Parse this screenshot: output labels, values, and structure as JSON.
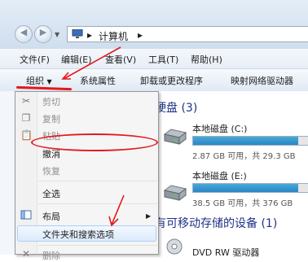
{
  "address": {
    "crumbs": [
      "计算机"
    ]
  },
  "menu": {
    "items": [
      "文件(F)",
      "编辑(E)",
      "查看(V)",
      "工具(T)",
      "帮助(H)"
    ]
  },
  "toolbar": {
    "organize_label": "组织",
    "items": [
      "系统属性",
      "卸载或更改程序",
      "映射网络驱动器"
    ]
  },
  "sections": {
    "hard_disks": "硬盘 (3)",
    "removable": "有可移动存储的设备 (1)"
  },
  "drives": [
    {
      "name": "本地磁盘 (C:)",
      "free_text": "2.87 GB 可用，共 29.3 GB",
      "used_fraction": 0.9
    },
    {
      "name": "本地磁盘 (E:)",
      "free_text": "38.5 GB 可用，共 376 GB",
      "used_fraction": 0.9
    },
    {
      "name": "DVD RW 驱动器"
    }
  ],
  "context_menu": {
    "items": [
      {
        "label": "剪切",
        "icon": "scissors-icon",
        "disabled": true
      },
      {
        "label": "复制",
        "icon": "copy-icon",
        "disabled": true
      },
      {
        "label": "粘贴",
        "icon": "paste-icon",
        "disabled": true
      },
      {
        "label": "撤消",
        "disabled": false
      },
      {
        "label": "恢复",
        "disabled": true
      },
      {
        "label": "全选",
        "disabled": false
      },
      {
        "label": "布局",
        "icon": "layout-icon",
        "submenu": true
      },
      {
        "label": "文件夹和搜索选项",
        "highlighted": true
      },
      {
        "label": "删除",
        "disabled": true
      }
    ]
  },
  "annotation_color": "#e5171c"
}
